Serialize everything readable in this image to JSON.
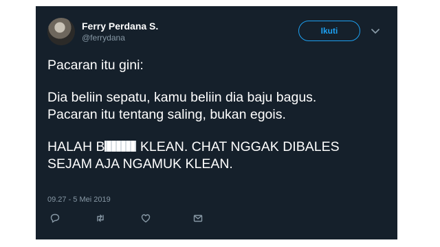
{
  "tweet": {
    "display_name": "Ferry Perdana S.",
    "handle": "@ferrydana",
    "follow_label": "Ikuti",
    "lines": [
      "Pacaran itu gini:",
      "Dia beliin sepatu, kamu beliin dia baju bagus.",
      "Pacaran itu tentang saling, bukan egois.",
      "KLEAN. CHAT NGGAK DIBALES",
      "SEJAM AJA NGAMUK KLEAN."
    ],
    "line4_prefix": "HALAH B",
    "timestamp": "09.27 - 5 Mei 2019"
  },
  "colors": {
    "card_bg": "#15202b",
    "accent": "#1da1f2",
    "muted": "#8899a6"
  },
  "icons": [
    "reply-icon",
    "retweet-icon",
    "like-icon",
    "message-icon",
    "chevron-down-icon"
  ]
}
